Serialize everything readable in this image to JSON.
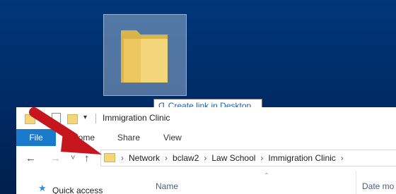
{
  "desktop": {
    "tooltip": {
      "glyph": "Ɑ",
      "text": "Create link in Desktop"
    }
  },
  "explorer": {
    "window_title": "Immigration Clinic",
    "ribbon_tabs": [
      "File",
      "Home",
      "Share",
      "View"
    ],
    "nav": {
      "back": "←",
      "forward": "→",
      "recent": "˅",
      "up": "↑"
    },
    "breadcrumb": [
      "Network",
      "bclaw2",
      "Law School",
      "Immigration Clinic"
    ],
    "breadcrumb_separator": "›",
    "sidebar": {
      "quick_access": "Quick access"
    },
    "columns": {
      "name": "Name",
      "date_modified": "Date mo"
    },
    "sort_indicator": "ˆ"
  },
  "colors": {
    "desktop_bg": "#00377a",
    "file_tab": "#1979ca",
    "folder": "#f3d57a",
    "tooltip_text": "#1b5fb8",
    "arrow": "#c4161c"
  },
  "icons": {
    "dragged_item": "folder-icon",
    "overlay": "red-arrow-annotation",
    "quick_access": "star-icon"
  }
}
